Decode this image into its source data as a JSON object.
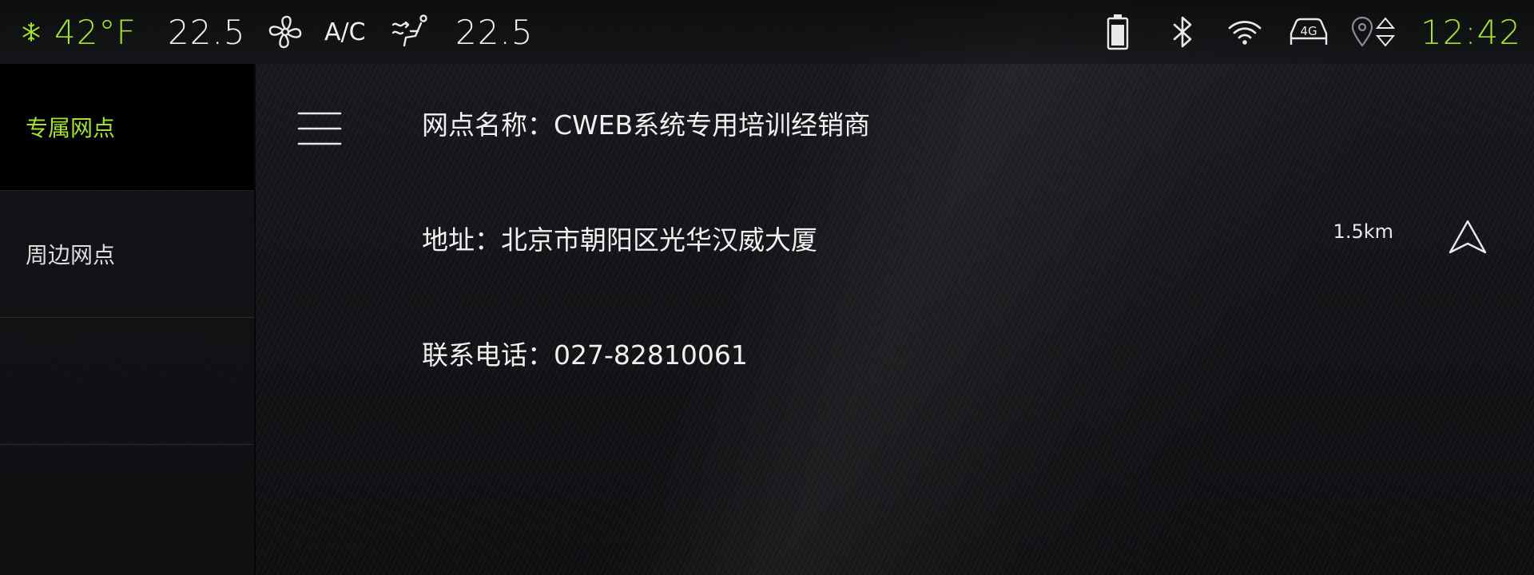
{
  "status_bar": {
    "outside_temp": "42°F",
    "driver_temp": "22.5",
    "ac_label": "A/C",
    "passenger_temp": "22.5",
    "clock": "12:42",
    "network_label": "4G",
    "icons": [
      "snowflake-icon",
      "fan-icon",
      "seat-airflow-icon",
      "battery-icon",
      "bluetooth-icon",
      "wifi-icon",
      "car-4g-icon",
      "location-icon",
      "up-down-arrows-icon"
    ]
  },
  "sidebar": {
    "items": [
      {
        "label": "专属网点",
        "active": true
      },
      {
        "label": "周边网点",
        "active": false
      }
    ]
  },
  "main": {
    "name_row": "网点名称：CWEB系统专用培训经销商",
    "address_row": "地址：北京市朝阳区光华汉威大厦",
    "distance": "1.5km",
    "phone_row": "联系电话：027-82810061"
  },
  "colors": {
    "accent": "#a4e22e",
    "background": "#15171a",
    "text": "#f0f0f0"
  }
}
